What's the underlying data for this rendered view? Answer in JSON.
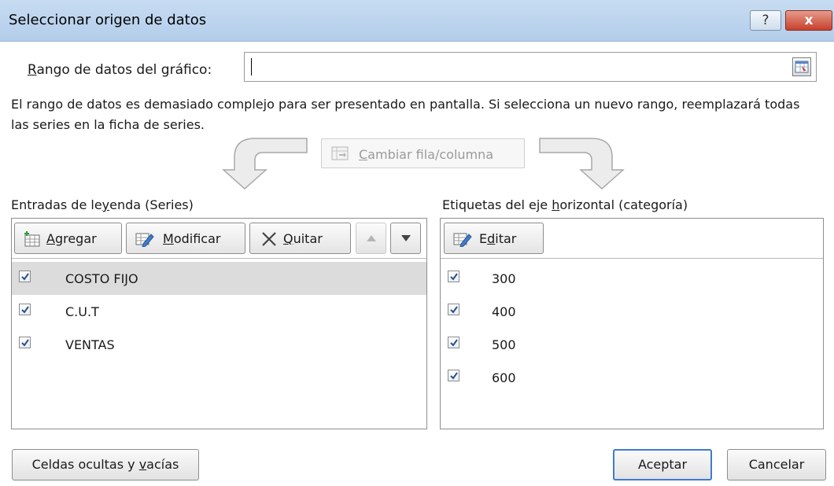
{
  "window": {
    "title": "Seleccionar origen de datos",
    "help_label": "?",
    "close_label": "x"
  },
  "range": {
    "label_pre": "",
    "label_access": "R",
    "label_post": "ango de datos del gráfico:",
    "value": ""
  },
  "info_text": "El rango de datos es demasiado complejo para ser presentado en pantalla. Si selecciona un nuevo rango, reemplazará todas las series en la ficha de series.",
  "switch_button": {
    "label_access": "C",
    "label_post": "ambiar fila/columna"
  },
  "legend": {
    "label_pre": "Entradas de le",
    "label_access": "y",
    "label_post": "enda (Series)",
    "toolbar": {
      "add_access": "A",
      "add_post": "gregar",
      "edit_access": "M",
      "edit_post": "odificar",
      "remove_access": "Q",
      "remove_post": "uitar"
    },
    "series": [
      {
        "name": "COSTO FIJO",
        "checked": true,
        "selected": true
      },
      {
        "name": "C.U.T",
        "checked": true,
        "selected": false
      },
      {
        "name": "VENTAS",
        "checked": true,
        "selected": false
      }
    ]
  },
  "axis": {
    "label_pre": "Etiquetas del eje ",
    "label_access": "h",
    "label_post": "orizontal (categoría)",
    "edit_pre": "E",
    "edit_access": "d",
    "edit_post": "itar",
    "categories": [
      {
        "value": "300",
        "checked": true
      },
      {
        "value": "400",
        "checked": true
      },
      {
        "value": "500",
        "checked": true
      },
      {
        "value": "600",
        "checked": true
      }
    ]
  },
  "footer": {
    "hidden_cells_pre": "Celdas ocultas y ",
    "hidden_cells_access": "v",
    "hidden_cells_post": "acías",
    "ok_label": "Aceptar",
    "cancel_label": "Cancelar"
  },
  "colors": {
    "titlebar": "#bcd4ee",
    "close_button": "#c7402c",
    "selected_row": "#dcdcdc",
    "default_button_border": "#3d7bd0"
  }
}
